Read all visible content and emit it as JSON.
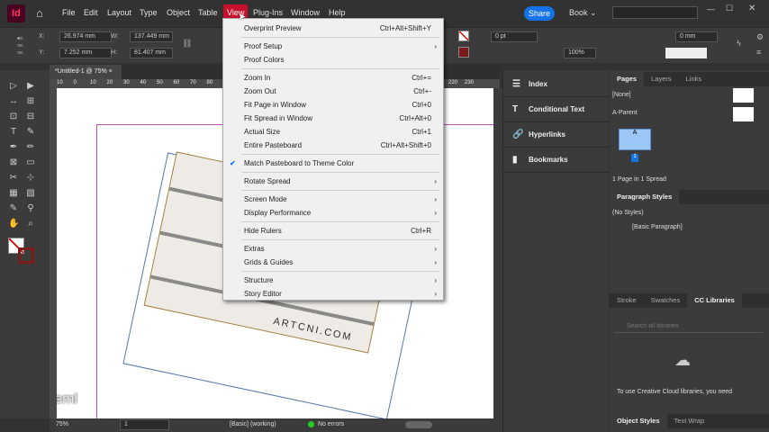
{
  "app": {
    "logo": "Id",
    "menus": [
      "File",
      "Edit",
      "Layout",
      "Type",
      "Object",
      "Table",
      "View",
      "Plug-Ins",
      "Window",
      "Help"
    ],
    "share": "Share",
    "workspace": "Book"
  },
  "control": {
    "x_label": "X:",
    "x": "26.974 mm",
    "y_label": "Y:",
    "y": "7.252 mm",
    "w_label": "W:",
    "w": "137.449 mm",
    "h_label": "H:",
    "h": "81.407 mm",
    "stroke": "0 pt",
    "scale": "100%",
    "offset": "0 mm"
  },
  "doc_tab": {
    "title": "*Untitled-1 @ 75%",
    "close": "×"
  },
  "ruler": [
    "10",
    "0",
    "10",
    "20",
    "30",
    "40",
    "50",
    "60",
    "70",
    "80",
    "220",
    "230"
  ],
  "view_menu": [
    {
      "label": "Overprint Preview",
      "shortcut": "Ctrl+Alt+Shift+Y"
    },
    {
      "sep": true
    },
    {
      "label": "Proof Setup",
      "submenu": true
    },
    {
      "label": "Proof Colors"
    },
    {
      "sep": true
    },
    {
      "label": "Zoom In",
      "shortcut": "Ctrl+="
    },
    {
      "label": "Zoom Out",
      "shortcut": "Ctrl+-"
    },
    {
      "label": "Fit Page in Window",
      "shortcut": "Ctrl+0"
    },
    {
      "label": "Fit Spread in Window",
      "shortcut": "Ctrl+Alt+0"
    },
    {
      "label": "Actual Size",
      "shortcut": "Ctrl+1"
    },
    {
      "label": "Entire Pasteboard",
      "shortcut": "Ctrl+Alt+Shift+0"
    },
    {
      "sep": true
    },
    {
      "label": "Match Pasteboard to Theme Color",
      "checked": true
    },
    {
      "sep": true
    },
    {
      "label": "Rotate Spread",
      "submenu": true
    },
    {
      "sep": true
    },
    {
      "label": "Screen Mode",
      "submenu": true
    },
    {
      "label": "Display Performance",
      "submenu": true
    },
    {
      "sep": true
    },
    {
      "label": "Hide Rulers",
      "shortcut": "Ctrl+R"
    },
    {
      "sep": true
    },
    {
      "label": "Extras",
      "submenu": true
    },
    {
      "label": "Grids & Guides",
      "submenu": true
    },
    {
      "sep": true
    },
    {
      "label": "Structure",
      "submenu": true
    },
    {
      "label": "Story Editor",
      "submenu": true
    }
  ],
  "collapsed_panels": [
    "Index",
    "Conditional Text",
    "Hyperlinks",
    "Bookmarks"
  ],
  "pages_panel": {
    "tabs": [
      "Pages",
      "Layers",
      "Links"
    ],
    "none": "[None]",
    "parent": "A-Parent",
    "page_letter": "A",
    "page_number": "1",
    "footer": "1 Page in 1 Spread"
  },
  "para_panel": {
    "title": "Paragraph Styles",
    "no_styles": "(No Styles)",
    "basic": "[Basic Paragraph]"
  },
  "cc_panel": {
    "tabs": [
      "Stroke",
      "Swatches",
      "CC Libraries"
    ],
    "search_placeholder": "Search all libraries",
    "message": "To use Creative Cloud libraries, you need"
  },
  "bottom_tabs": [
    "Object Styles",
    "Text Wrap"
  ],
  "status": {
    "zoom": "75%",
    "page": "1",
    "style": "[Basic] (working)",
    "errors": "No errors"
  },
  "watermark": "/fs.saleml",
  "artwork_text": "ARTCNI.COM",
  "colors": {
    "accent": "#1473e6",
    "menu_bg": "#f0f0f0",
    "chrome": "#323232"
  }
}
